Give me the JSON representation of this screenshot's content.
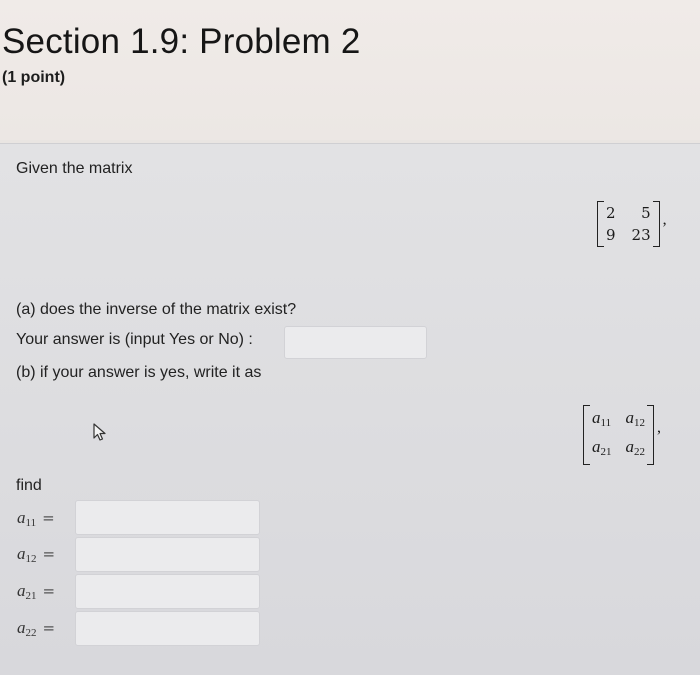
{
  "header": {
    "title": "Section 1.9: Problem 2",
    "points": "(1 point)"
  },
  "problem": {
    "intro": "Given the matrix",
    "matrix": {
      "r1c1": "2",
      "r1c2": "5",
      "r2c1": "9",
      "r2c2": "23",
      "trailing": ","
    },
    "part_a": "(a) does the inverse of the matrix exist?",
    "answer_prompt": "Your answer is (input Yes or No) :",
    "answer_value": "",
    "part_b": "(b) if your answer is yes, write it as",
    "inverse_matrix": {
      "r1c1": "a",
      "r1c1_sub": "11",
      "r1c2": "a",
      "r1c2_sub": "12",
      "r2c1": "a",
      "r2c1_sub": "21",
      "r2c2": "a",
      "r2c2_sub": "22",
      "trailing": ","
    },
    "find_label": "find",
    "fields": [
      {
        "var": "a",
        "sub": "11",
        "eq": "=",
        "value": ""
      },
      {
        "var": "a",
        "sub": "12",
        "eq": "=",
        "value": ""
      },
      {
        "var": "a",
        "sub": "21",
        "eq": "=",
        "value": ""
      },
      {
        "var": "a",
        "sub": "22",
        "eq": "=",
        "value": ""
      }
    ]
  },
  "icons": {
    "cursor": "mouse-pointer-icon"
  },
  "colors": {
    "header_bg": "#ece7e4",
    "panel_bg": "#dedee1",
    "input_bg": "#ebebed"
  }
}
